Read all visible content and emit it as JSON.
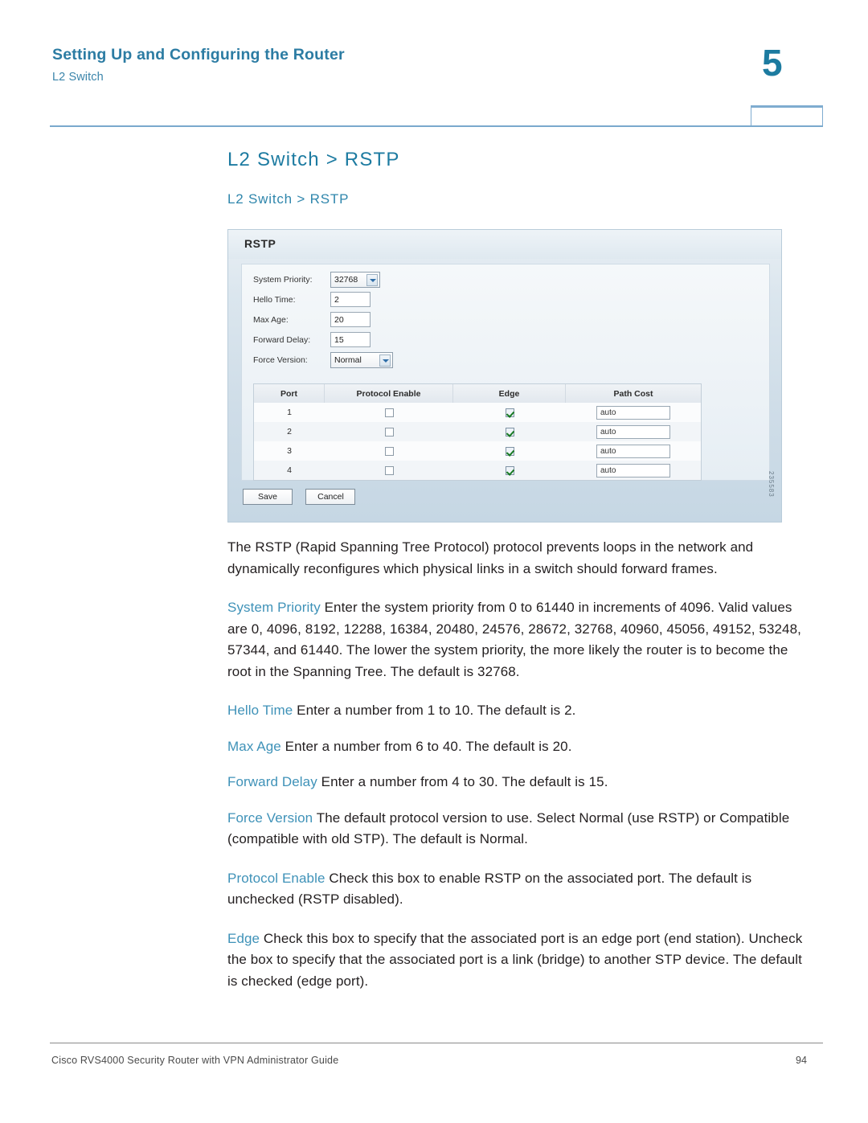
{
  "header": {
    "title": "Setting Up and Configuring the Router",
    "subtitle": "L2 Switch",
    "chapter_number": "5",
    "accent_color": "#2c7ca3"
  },
  "section": {
    "title": "L2 Switch > RSTP",
    "subtitle": "L2 Switch > RSTP"
  },
  "figure": {
    "panel_title": "RSTP",
    "figure_id": "235583",
    "form": {
      "fields": [
        {
          "label": "System Priority:",
          "value": "32768",
          "control": "select"
        },
        {
          "label": "Hello Time:",
          "value": "2",
          "control": "text"
        },
        {
          "label": "Max Age:",
          "value": "20",
          "control": "text"
        },
        {
          "label": "Forward Delay:",
          "value": "15",
          "control": "text"
        },
        {
          "label": "Force Version:",
          "value": "Normal",
          "control": "select"
        }
      ]
    },
    "table": {
      "columns": [
        "Port",
        "Protocol Enable",
        "Edge",
        "Path Cost"
      ],
      "rows": [
        {
          "port": "1",
          "protocol_enable": false,
          "edge": true,
          "path_cost": "auto"
        },
        {
          "port": "2",
          "protocol_enable": false,
          "edge": true,
          "path_cost": "auto"
        },
        {
          "port": "3",
          "protocol_enable": false,
          "edge": true,
          "path_cost": "auto"
        },
        {
          "port": "4",
          "protocol_enable": false,
          "edge": true,
          "path_cost": "auto"
        }
      ]
    },
    "buttons": {
      "save": "Save",
      "cancel": "Cancel"
    }
  },
  "body": {
    "intro": "The RSTP (Rapid Spanning Tree Protocol) protocol prevents loops in the network and dynamically reconfigures which physical links in a switch should forward frames.",
    "definitions": [
      {
        "term": "System Priority",
        "text": " Enter the system priority from 0 to 61440 in increments of 4096. Valid values are 0, 4096, 8192, 12288, 16384, 20480, 24576, 28672, 32768, 40960, 45056, 49152, 53248, 57344, and 61440. The lower the system priority, the more likely the router is to become the root in the Spanning Tree. The default is 32768."
      },
      {
        "term": "Hello Time",
        "text": " Enter a number from 1 to 10. The default is 2."
      },
      {
        "term": "Max Age",
        "text": " Enter a number from 6 to 40. The default is 20."
      },
      {
        "term": "Forward Delay",
        "text": " Enter a number from 4 to 30. The default is 15."
      },
      {
        "term": "Force Version",
        "text": " The default protocol version to use. Select Normal (use RSTP) or Compatible (compatible with old STP). The default is Normal."
      },
      {
        "term": "Protocol Enable",
        "text": " Check this box to enable RSTP on the associated port. The default is unchecked (RSTP disabled)."
      },
      {
        "term": "Edge",
        "text": " Check this box to specify that the associated port is an edge port (end station). Uncheck the box to specify that the associated port is a link (bridge) to another STP device. The default is checked (edge port)."
      }
    ]
  },
  "footer": {
    "document_title": "Cisco RVS4000 Security Router with VPN Administrator Guide",
    "page_number": "94"
  }
}
